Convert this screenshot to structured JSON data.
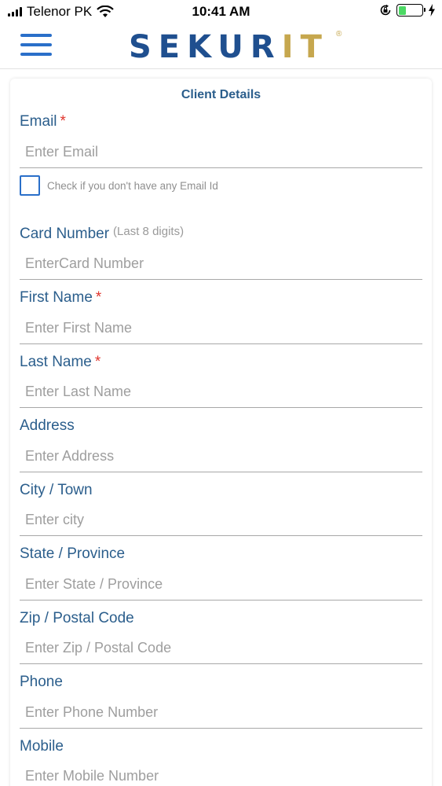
{
  "status_bar": {
    "carrier": "Telenor PK",
    "time": "10:41 AM"
  },
  "header": {
    "logo_part1": "SEKUR",
    "logo_part2": "IT",
    "logo_reg": "®",
    "colors": {
      "brand_blue": "#1f4f8f",
      "brand_gold": "#c6a74e",
      "menu_blue": "#2a6fc9"
    }
  },
  "form": {
    "title": "Client Details",
    "required_mark": "*",
    "email": {
      "label": "Email",
      "placeholder": "Enter Email"
    },
    "no_email_checkbox": {
      "label": "Check if you don't have any Email Id",
      "checked": false
    },
    "card_number": {
      "label": "Card Number",
      "hint": "(Last 8 digits)",
      "placeholder": "EnterCard Number"
    },
    "first_name": {
      "label": "First Name",
      "placeholder": "Enter First Name"
    },
    "last_name": {
      "label": "Last Name",
      "placeholder": "Enter Last Name"
    },
    "address": {
      "label": "Address",
      "placeholder": "Enter Address"
    },
    "city": {
      "label": "City / Town",
      "placeholder": "Enter city"
    },
    "state": {
      "label": "State / Province",
      "placeholder": "Enter State / Province"
    },
    "zip": {
      "label": "Zip / Postal Code",
      "placeholder": "Enter Zip / Postal Code"
    },
    "phone": {
      "label": "Phone",
      "placeholder": "Enter Phone Number"
    },
    "mobile": {
      "label": "Mobile",
      "placeholder": "Enter Mobile Number"
    }
  }
}
